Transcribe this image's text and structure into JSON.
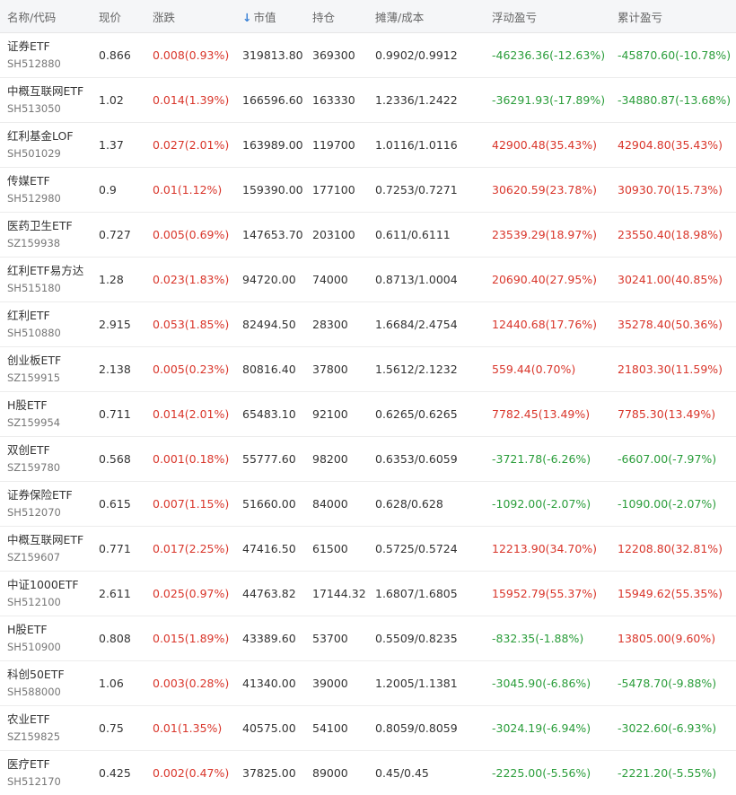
{
  "colors": {
    "up": "#d9362b",
    "down": "#2a9d3a",
    "sort_arrow": "#3b82d6"
  },
  "header": {
    "name": "名称/代码",
    "price": "现价",
    "change": "涨跌",
    "sort_arrow": "↓",
    "market_value": "市值",
    "holding": "持仓",
    "cost": "摊薄/成本",
    "float_pl": "浮动盈亏",
    "total_pl": "累计盈亏"
  },
  "rows": [
    {
      "name": "证券ETF",
      "code": "SH512880",
      "price": "0.866",
      "change": "0.008(0.93%)",
      "change_dir": "up",
      "market_value": "319813.80",
      "holding": "369300",
      "cost": "0.9902/0.9912",
      "float_pl": "-46236.36(-12.63%)",
      "float_dir": "down",
      "total_pl": "-45870.60(-10.78%)",
      "total_dir": "down"
    },
    {
      "name": "中概互联网ETF",
      "code": "SH513050",
      "price": "1.02",
      "change": "0.014(1.39%)",
      "change_dir": "up",
      "market_value": "166596.60",
      "holding": "163330",
      "cost": "1.2336/1.2422",
      "float_pl": "-36291.93(-17.89%)",
      "float_dir": "down",
      "total_pl": "-34880.87(-13.68%)",
      "total_dir": "down"
    },
    {
      "name": "红利基金LOF",
      "code": "SH501029",
      "price": "1.37",
      "change": "0.027(2.01%)",
      "change_dir": "up",
      "market_value": "163989.00",
      "holding": "119700",
      "cost": "1.0116/1.0116",
      "float_pl": "42900.48(35.43%)",
      "float_dir": "up",
      "total_pl": "42904.80(35.43%)",
      "total_dir": "up"
    },
    {
      "name": "传媒ETF",
      "code": "SH512980",
      "price": "0.9",
      "change": "0.01(1.12%)",
      "change_dir": "up",
      "market_value": "159390.00",
      "holding": "177100",
      "cost": "0.7253/0.7271",
      "float_pl": "30620.59(23.78%)",
      "float_dir": "up",
      "total_pl": "30930.70(15.73%)",
      "total_dir": "up"
    },
    {
      "name": "医药卫生ETF",
      "code": "SZ159938",
      "price": "0.727",
      "change": "0.005(0.69%)",
      "change_dir": "up",
      "market_value": "147653.70",
      "holding": "203100",
      "cost": "0.611/0.6111",
      "float_pl": "23539.29(18.97%)",
      "float_dir": "up",
      "total_pl": "23550.40(18.98%)",
      "total_dir": "up"
    },
    {
      "name": "红利ETF易方达",
      "code": "SH515180",
      "price": "1.28",
      "change": "0.023(1.83%)",
      "change_dir": "up",
      "market_value": "94720.00",
      "holding": "74000",
      "cost": "0.8713/1.0004",
      "float_pl": "20690.40(27.95%)",
      "float_dir": "up",
      "total_pl": "30241.00(40.85%)",
      "total_dir": "up"
    },
    {
      "name": "红利ETF",
      "code": "SH510880",
      "price": "2.915",
      "change": "0.053(1.85%)",
      "change_dir": "up",
      "market_value": "82494.50",
      "holding": "28300",
      "cost": "1.6684/2.4754",
      "float_pl": "12440.68(17.76%)",
      "float_dir": "up",
      "total_pl": "35278.40(50.36%)",
      "total_dir": "up"
    },
    {
      "name": "创业板ETF",
      "code": "SZ159915",
      "price": "2.138",
      "change": "0.005(0.23%)",
      "change_dir": "up",
      "market_value": "80816.40",
      "holding": "37800",
      "cost": "1.5612/2.1232",
      "float_pl": "559.44(0.70%)",
      "float_dir": "up",
      "total_pl": "21803.30(11.59%)",
      "total_dir": "up"
    },
    {
      "name": "H股ETF",
      "code": "SZ159954",
      "price": "0.711",
      "change": "0.014(2.01%)",
      "change_dir": "up",
      "market_value": "65483.10",
      "holding": "92100",
      "cost": "0.6265/0.6265",
      "float_pl": "7782.45(13.49%)",
      "float_dir": "up",
      "total_pl": "7785.30(13.49%)",
      "total_dir": "up"
    },
    {
      "name": "双创ETF",
      "code": "SZ159780",
      "price": "0.568",
      "change": "0.001(0.18%)",
      "change_dir": "up",
      "market_value": "55777.60",
      "holding": "98200",
      "cost": "0.6353/0.6059",
      "float_pl": "-3721.78(-6.26%)",
      "float_dir": "down",
      "total_pl": "-6607.00(-7.97%)",
      "total_dir": "down"
    },
    {
      "name": "证券保险ETF",
      "code": "SH512070",
      "price": "0.615",
      "change": "0.007(1.15%)",
      "change_dir": "up",
      "market_value": "51660.00",
      "holding": "84000",
      "cost": "0.628/0.628",
      "float_pl": "-1092.00(-2.07%)",
      "float_dir": "down",
      "total_pl": "-1090.00(-2.07%)",
      "total_dir": "down"
    },
    {
      "name": "中概互联网ETF",
      "code": "SZ159607",
      "price": "0.771",
      "change": "0.017(2.25%)",
      "change_dir": "up",
      "market_value": "47416.50",
      "holding": "61500",
      "cost": "0.5725/0.5724",
      "float_pl": "12213.90(34.70%)",
      "float_dir": "up",
      "total_pl": "12208.80(32.81%)",
      "total_dir": "up"
    },
    {
      "name": "中证1000ETF",
      "code": "SH512100",
      "price": "2.611",
      "change": "0.025(0.97%)",
      "change_dir": "up",
      "market_value": "44763.82",
      "holding": "17144.32",
      "cost": "1.6807/1.6805",
      "float_pl": "15952.79(55.37%)",
      "float_dir": "up",
      "total_pl": "15949.62(55.35%)",
      "total_dir": "up"
    },
    {
      "name": "H股ETF",
      "code": "SH510900",
      "price": "0.808",
      "change": "0.015(1.89%)",
      "change_dir": "up",
      "market_value": "43389.60",
      "holding": "53700",
      "cost": "0.5509/0.8235",
      "float_pl": "-832.35(-1.88%)",
      "float_dir": "down",
      "total_pl": "13805.00(9.60%)",
      "total_dir": "up"
    },
    {
      "name": "科创50ETF",
      "code": "SH588000",
      "price": "1.06",
      "change": "0.003(0.28%)",
      "change_dir": "up",
      "market_value": "41340.00",
      "holding": "39000",
      "cost": "1.2005/1.1381",
      "float_pl": "-3045.90(-6.86%)",
      "float_dir": "down",
      "total_pl": "-5478.70(-9.88%)",
      "total_dir": "down"
    },
    {
      "name": "农业ETF",
      "code": "SZ159825",
      "price": "0.75",
      "change": "0.01(1.35%)",
      "change_dir": "up",
      "market_value": "40575.00",
      "holding": "54100",
      "cost": "0.8059/0.8059",
      "float_pl": "-3024.19(-6.94%)",
      "float_dir": "down",
      "total_pl": "-3022.60(-6.93%)",
      "total_dir": "down"
    },
    {
      "name": "医疗ETF",
      "code": "SH512170",
      "price": "0.425",
      "change": "0.002(0.47%)",
      "change_dir": "up",
      "market_value": "37825.00",
      "holding": "89000",
      "cost": "0.45/0.45",
      "float_pl": "-2225.00(-5.56%)",
      "float_dir": "down",
      "total_pl": "-2221.20(-5.55%)",
      "total_dir": "down"
    }
  ]
}
